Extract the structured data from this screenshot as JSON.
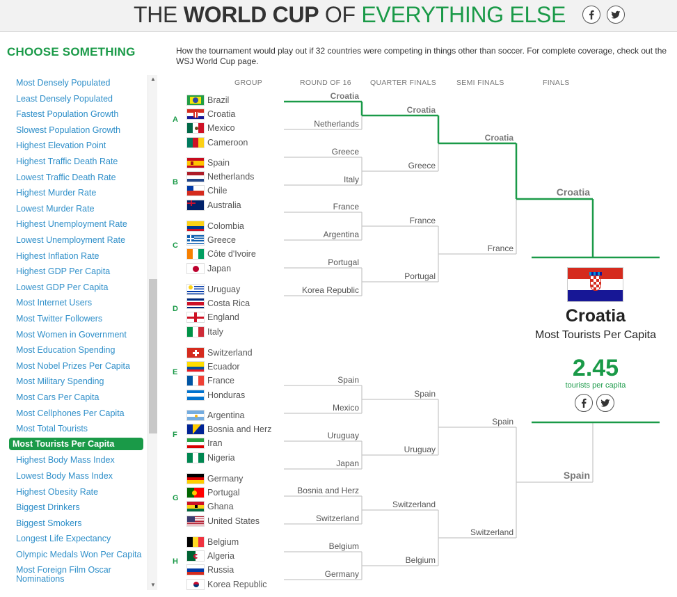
{
  "header": {
    "title_part1": "THE ",
    "title_part2": "WORLD CUP",
    "title_part3": " OF ",
    "title_part4": "EVERYTHING ELSE",
    "share_icons": [
      "facebook-icon",
      "twitter-icon"
    ]
  },
  "sidebar": {
    "title": "CHOOSE SOMETHING",
    "items": [
      "Most Densely Populated",
      "Least Densely Populated",
      "Fastest Population Growth",
      "Slowest Population Growth",
      "Highest Elevation Point",
      "Highest Traffic Death Rate",
      "Lowest Traffic Death Rate",
      "Highest Murder Rate",
      "Lowest Murder Rate",
      "Highest Unemployment Rate",
      "Lowest Unemployment Rate",
      "Highest Inflation Rate",
      "Highest GDP Per Capita",
      "Lowest GDP Per Capita",
      "Most Internet Users",
      "Most Twitter Followers",
      "Most Women in Government",
      "Most Education Spending",
      "Most Nobel Prizes Per Capita",
      "Most Military Spending",
      "Most Cars Per Capita",
      "Most Cellphones Per Capita",
      "Most Total Tourists",
      "Most Tourists Per Capita",
      "Highest Body Mass Index",
      "Lowest Body Mass Index",
      "Highest Obesity Rate",
      "Biggest Drinkers",
      "Biggest Smokers",
      "Longest Life Expectancy",
      "Olympic Medals Won Per Capita",
      "Most Foreign Film Oscar Nominations"
    ],
    "active_index": 23
  },
  "intro": {
    "text": "How the tournament would play out if 32 countries were competing in things other than soccer. For complete coverage, check out the WSJ World Cup page."
  },
  "columns": [
    "GROUP",
    "ROUND OF 16",
    "QUARTER FINALS",
    "SEMI FINALS",
    "FINALS"
  ],
  "groups": [
    {
      "letter": "A",
      "teams": [
        "Brazil",
        "Croatia",
        "Mexico",
        "Cameroon"
      ]
    },
    {
      "letter": "B",
      "teams": [
        "Spain",
        "Netherlands",
        "Chile",
        "Australia"
      ]
    },
    {
      "letter": "C",
      "teams": [
        "Colombia",
        "Greece",
        "Côte d'Ivoire",
        "Japan"
      ]
    },
    {
      "letter": "D",
      "teams": [
        "Uruguay",
        "Costa Rica",
        "England",
        "Italy"
      ]
    },
    {
      "letter": "E",
      "teams": [
        "Switzerland",
        "Ecuador",
        "France",
        "Honduras"
      ]
    },
    {
      "letter": "F",
      "teams": [
        "Argentina",
        "Bosnia and Herz",
        "Iran",
        "Nigeria"
      ]
    },
    {
      "letter": "G",
      "teams": [
        "Germany",
        "Portugal",
        "Ghana",
        "United States"
      ]
    },
    {
      "letter": "H",
      "teams": [
        "Belgium",
        "Algeria",
        "Russia",
        "Korea Republic"
      ]
    }
  ],
  "round_of_16": [
    "Croatia",
    "Netherlands",
    "Greece",
    "Italy",
    "France",
    "Argentina",
    "Portugal",
    "Korea Republic",
    "Spain",
    "Mexico",
    "Uruguay",
    "Japan",
    "Bosnia and Herz",
    "Switzerland",
    "Belgium",
    "Germany"
  ],
  "quarter_finals": [
    "Croatia",
    "Greece",
    "France",
    "Portugal",
    "Spain",
    "Uruguay",
    "Switzerland",
    "Belgium"
  ],
  "semi_finals": [
    "Croatia",
    "France",
    "Spain",
    "Switzerland"
  ],
  "finals": [
    "Croatia",
    "Spain"
  ],
  "champion": {
    "name": "Croatia",
    "category": "Most Tourists Per Capita",
    "value": "2.45",
    "unit": "tourists per capita"
  },
  "colors": {
    "accent": "#1a9a48",
    "link": "#2f8fc9",
    "bracket_line": "#c8c8c8"
  }
}
